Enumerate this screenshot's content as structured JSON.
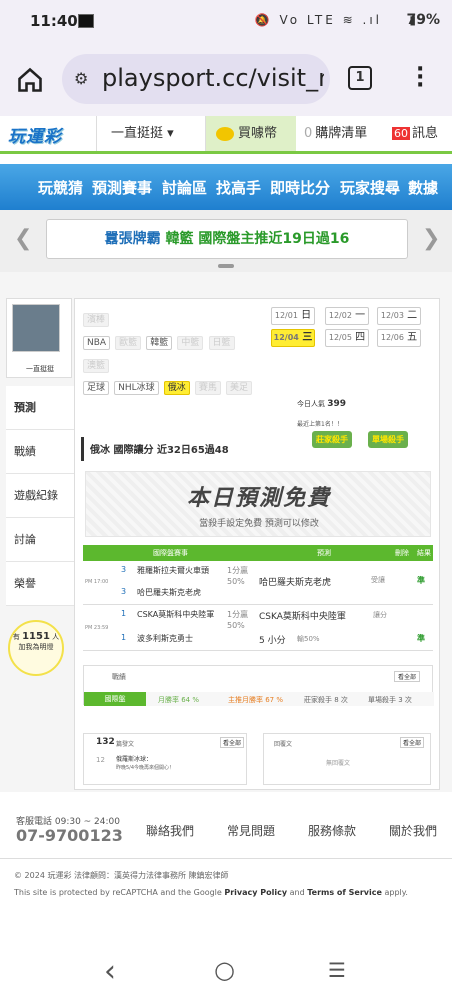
{
  "status": {
    "time": "11:40",
    "icons": "🔕 Vo LTE ≋ .ıl",
    "battery": "79%"
  },
  "browser": {
    "url": "playsport.cc/visit_m",
    "tabs_count": "1"
  },
  "header": {
    "logo": "玩運彩",
    "user_menu": "一直挺挺 ▾",
    "coin_label": "買噱幣",
    "cart_count": "0",
    "cart_label": "購牌清單",
    "msg_count": "60",
    "msg_label": "訊息"
  },
  "nav": [
    "玩競猜",
    "預測賽事",
    "討論區",
    "找高手",
    "即時比分",
    "玩家搜尋",
    "數據"
  ],
  "ticker": {
    "prefix": "囂張牌霸",
    "text": "韓籃 國際盤主推近19日過16"
  },
  "sidebar": {
    "username": "一直挺挺",
    "items": [
      "預測",
      "戰績",
      "遊戲紀錄",
      "討論",
      "榮譽"
    ],
    "online_prefix": "有",
    "online_count": "1151",
    "online_suffix": "人",
    "online_line2": "加我為明燈"
  },
  "categories": {
    "row1": [
      "濱棒"
    ],
    "row2": [
      "NBA",
      "歐籃",
      "韓籃",
      "中籃",
      "日籃"
    ],
    "row3": [
      "澳籃"
    ],
    "row4": [
      "足球",
      "NHL冰球",
      "俄冰",
      "賽馬",
      "美足"
    ]
  },
  "dates": [
    {
      "d": "12/01",
      "w": "日"
    },
    {
      "d": "12/02",
      "w": "一"
    },
    {
      "d": "12/03",
      "w": "二"
    },
    {
      "d": "12/04",
      "w": "三"
    },
    {
      "d": "12/05",
      "w": "四"
    },
    {
      "d": "12/06",
      "w": "五"
    }
  ],
  "stats": {
    "today_label": "今日人氣",
    "today_value": "399",
    "rank_text": "最近上第1名！！"
  },
  "section": {
    "title": "俄冰 國際讓分 近32日65過48",
    "badge1": "莊家殺手",
    "badge2": "單場殺手"
  },
  "free": {
    "title": "本日預測免費",
    "subtitle": "當殺手設定免費  預測可以修改"
  },
  "table": {
    "headers": [
      "國際盤賽事",
      "預測",
      "刪除",
      "結果"
    ],
    "games": [
      {
        "time": "PM 17:00",
        "n1": "3",
        "team1": "雅羅斯拉夫爾火車頭",
        "n2": "3",
        "team2": "哈巴羅夫斯克老虎",
        "odds1": "1分贏",
        "odds2": "50%",
        "pick": "哈巴羅夫斯克老虎",
        "pick_note": "受讓",
        "result": "準"
      },
      {
        "time": "PM 23:59",
        "n1": "1",
        "team1": "CSKA莫斯科中央陸軍",
        "n2": "1",
        "team2": "波多利斯克勇士",
        "odds1": "1分贏",
        "odds2": "50%",
        "pick": "CSKA莫斯科中央陸軍",
        "pick_note": "讓分",
        "pick2": "5 小分",
        "pick2_note": "輸50%",
        "result": "準"
      }
    ]
  },
  "record": {
    "label": "戰績",
    "see_all": "看全部",
    "tab": "國際盤",
    "items": [
      "月勝率 64 %",
      "主推月勝率 67 %",
      "莊家殺手 8 次",
      "單場殺手 3 次"
    ]
  },
  "posts": {
    "count": "132",
    "label": "篇發文",
    "see_all": "看全部",
    "item_num": "12",
    "item_title": "俄羅斯冰球：",
    "item_text": "昨晚5/4今晚再來個開心！",
    "right_label": "回覆文",
    "right_see_all": "看全部",
    "right_empty": "無回覆文"
  },
  "footer": {
    "phone_label": "客服電話 09:30 ~ 24:00",
    "phone": "07-9700123",
    "links": [
      "聯絡我們",
      "常見問題",
      "服務條款",
      "關於我們"
    ],
    "copyright": "© 2024 玩運彩 法律顧問：漢英得力法律事務所 陳鎮宏律師",
    "recaptcha": "This site is protected by reCAPTCHA and the Google",
    "privacy": "Privacy Policy",
    "and": "and",
    "terms": "Terms of Service",
    "apply": "apply."
  },
  "navbar": {
    "back": "‹",
    "home": "○",
    "recents": "☰"
  }
}
